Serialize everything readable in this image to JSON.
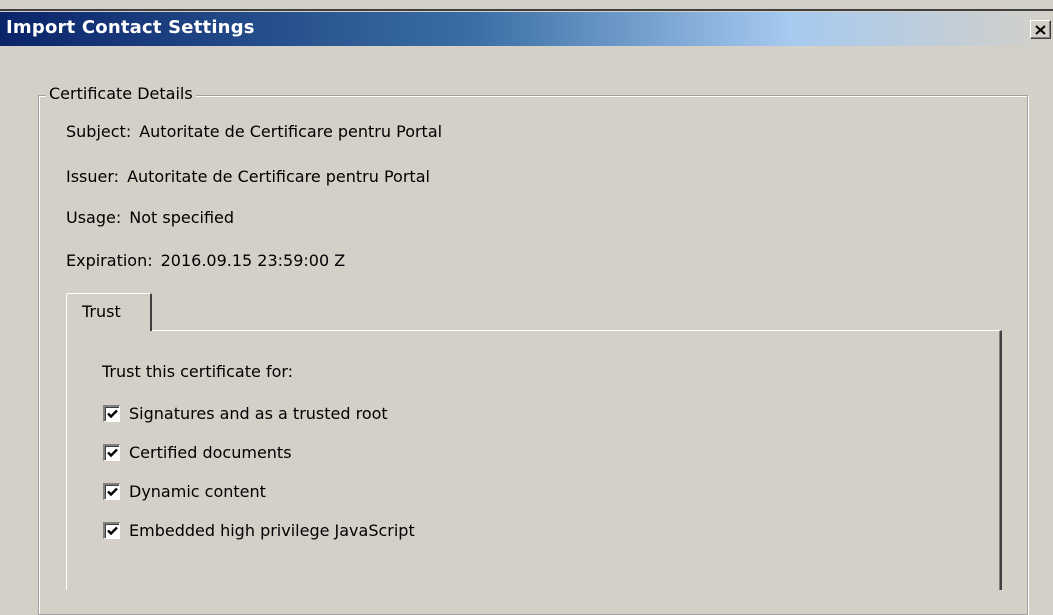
{
  "window": {
    "title": "Import Contact Settings"
  },
  "certificate_details": {
    "legend": "Certificate Details",
    "subject_label": "Subject:",
    "subject_value": "Autoritate de Certificare pentru Portal",
    "issuer_label": "Issuer:",
    "issuer_value": "Autoritate de Certificare pentru Portal",
    "usage_label": "Usage:",
    "usage_value": "Not specified",
    "expiration_label": "Expiration:",
    "expiration_value": "2016.09.15 23:59:00 Z"
  },
  "tabs": {
    "trust_label": "Trust"
  },
  "trust": {
    "heading": "Trust this certificate for:",
    "options": [
      {
        "label": "Signatures and as a trusted root",
        "checked": true
      },
      {
        "label": "Certified documents",
        "checked": true
      },
      {
        "label": "Dynamic content",
        "checked": true
      },
      {
        "label": "Embedded high privilege JavaScript",
        "checked": true
      }
    ]
  },
  "icons": {
    "close": "close-icon",
    "check": "checkmark-icon"
  },
  "colors": {
    "titlebar_start": "#0a246a",
    "titlebar_end": "#a6caf0",
    "face": "#d4d0c8"
  }
}
